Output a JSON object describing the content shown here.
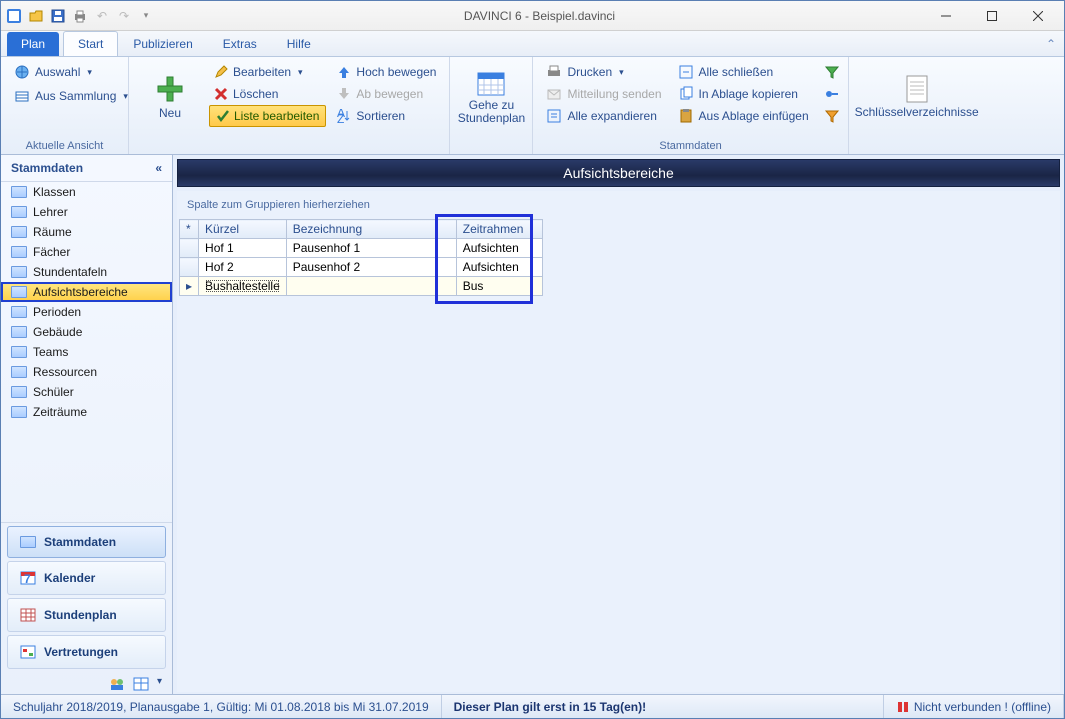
{
  "window": {
    "title": "DAVINCI 6 - Beispiel.davinci"
  },
  "tabs": {
    "file": "Plan",
    "items": [
      "Start",
      "Publizieren",
      "Extras",
      "Hilfe"
    ],
    "active": 0
  },
  "ribbon": {
    "auswahl": "Auswahl",
    "aus_sammlung": "Aus Sammlung",
    "group1_label": "Aktuelle Ansicht",
    "neu": "Neu",
    "bearbeiten": "Bearbeiten",
    "loeschen": "Löschen",
    "liste_bearbeiten": "Liste bearbeiten",
    "hoch": "Hoch bewegen",
    "ab": "Ab bewegen",
    "sortieren": "Sortieren",
    "gehe_zu": "Gehe zu Stundenplan",
    "drucken": "Drucken",
    "mitteilung": "Mitteilung senden",
    "alle_exp": "Alle expandieren",
    "alle_schl": "Alle schließen",
    "in_ablage": "In Ablage kopieren",
    "aus_ablage": "Aus Ablage einfügen",
    "schluessel": "Schlüsselverzeichnisse",
    "group_stamm": "Stammdaten"
  },
  "sidebar": {
    "header": "Stammdaten",
    "items": [
      {
        "label": "Klassen"
      },
      {
        "label": "Lehrer"
      },
      {
        "label": "Räume"
      },
      {
        "label": "Fächer"
      },
      {
        "label": "Stundentafeln"
      },
      {
        "label": "Aufsichtsbereiche",
        "selected": true
      },
      {
        "label": "Perioden"
      },
      {
        "label": "Gebäude"
      },
      {
        "label": "Teams"
      },
      {
        "label": "Ressourcen"
      },
      {
        "label": "Schüler"
      },
      {
        "label": "Zeiträume"
      }
    ],
    "nav": [
      {
        "label": "Stammdaten",
        "active": true
      },
      {
        "label": "Kalender"
      },
      {
        "label": "Stundenplan"
      },
      {
        "label": "Vertretungen"
      }
    ]
  },
  "content": {
    "title": "Aufsichtsbereiche",
    "group_hint": "Spalte zum Gruppieren hierherziehen",
    "columns": [
      "Kürzel",
      "Bezeichnung",
      "Zeitrahmen"
    ],
    "rows": [
      {
        "k": "Hof 1",
        "b": "Pausenhof 1",
        "z": "Aufsichten"
      },
      {
        "k": "Hof 2",
        "b": "Pausenhof 2",
        "z": "Aufsichten"
      },
      {
        "k": "Bushaltestelle",
        "b": "",
        "z": "Bus",
        "editing": true
      }
    ]
  },
  "status": {
    "left": "Schuljahr 2018/2019, Planausgabe 1, Gültig: Mi 01.08.2018 bis Mi 31.07.2019",
    "mid": "Dieser Plan gilt erst in 15 Tag(en)!",
    "right": "Nicht verbunden ! (offline)"
  }
}
